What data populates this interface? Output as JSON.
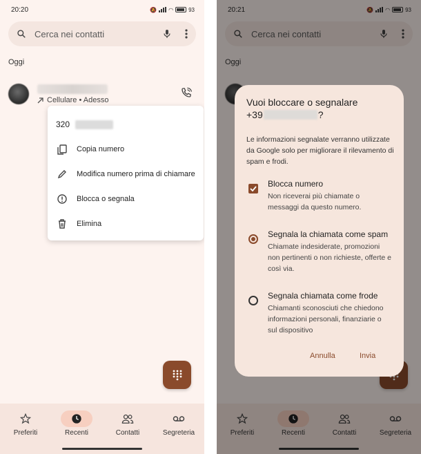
{
  "left": {
    "status": {
      "time": "20:20",
      "battery": "93"
    },
    "search": {
      "placeholder": "Cerca nei contatti"
    },
    "section": "Oggi",
    "call": {
      "detail": "Cellulare • Adesso"
    },
    "menu": {
      "number_prefix": "320",
      "items": [
        {
          "label": "Copia numero",
          "icon": "copy-icon"
        },
        {
          "label": "Modifica numero prima di chiamare",
          "icon": "pencil-icon"
        },
        {
          "label": "Blocca o segnala",
          "icon": "block-icon"
        },
        {
          "label": "Elimina",
          "icon": "trash-icon"
        }
      ]
    }
  },
  "right": {
    "status": {
      "time": "20:21",
      "battery": "93"
    },
    "search": {
      "placeholder": "Cerca nei contatti"
    },
    "section": "Oggi",
    "dialog": {
      "title_line1": "Vuoi bloccare o segnalare",
      "title_prefix": "+39",
      "title_suffix": "?",
      "body": "Le informazioni segnalate verranno utilizzate da Google solo per migliorare il rilevamento di spam e frodi.",
      "options": [
        {
          "title": "Blocca numero",
          "desc": "Non riceverai più chiamate o messaggi da questo numero.",
          "control": "checkbox",
          "checked": true
        },
        {
          "title": "Segnala la chiamata come spam",
          "desc": "Chiamate indesiderate, promozioni non pertinenti o non richieste, offerte e così via.",
          "control": "radio",
          "checked": true
        },
        {
          "title": "Segnala chiamata come frode",
          "desc": "Chiamanti sconosciuti che chiedono informazioni personali, finanziarie o sul dispositivo",
          "control": "radio",
          "checked": false
        }
      ],
      "cancel": "Annulla",
      "send": "Invia"
    }
  },
  "nav": [
    {
      "label": "Preferiti",
      "icon": "star-icon",
      "active": false
    },
    {
      "label": "Recenti",
      "icon": "clock-icon",
      "active": true
    },
    {
      "label": "Contatti",
      "icon": "people-icon",
      "active": false
    },
    {
      "label": "Segreteria",
      "icon": "voicemail-icon",
      "active": false
    }
  ],
  "colors": {
    "accent": "#8a4a2b",
    "background": "#fdf3ef",
    "nav_active": "#f7cfc0"
  }
}
